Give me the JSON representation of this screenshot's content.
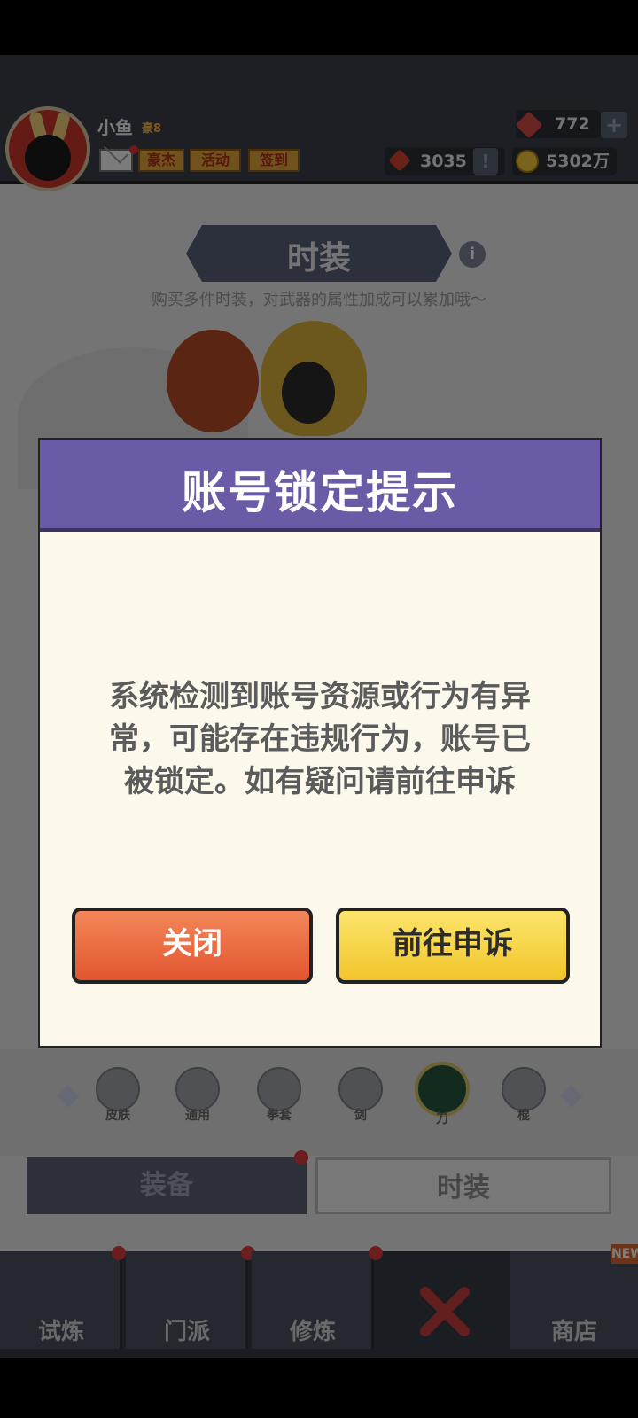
{
  "player": {
    "name": "小鱼",
    "vip": "豪8"
  },
  "hud": {
    "buttons": [
      "豪杰",
      "活动",
      "签到"
    ],
    "gems": "772",
    "tokens": "3035",
    "coins": "5302万"
  },
  "page": {
    "title": "时装",
    "subtitle": "购买多件时装，对武器的属性加成可以累加哦～"
  },
  "weapons": [
    "皮肤",
    "通用",
    "拳套",
    "剑",
    "刀",
    "棍"
  ],
  "tabs": {
    "left": "装备",
    "right": "时装"
  },
  "nav": [
    "试炼",
    "门派",
    "修炼",
    "",
    "商店"
  ],
  "new_badge": "NEW",
  "dialog": {
    "title": "账号锁定提示",
    "message_lines": [
      "系统检测到账号资源或行为有异",
      "常，可能存在违规行为，账号已",
      "被锁定。如有疑问请前往申诉"
    ],
    "close_label": "关闭",
    "appeal_label": "前往申诉"
  }
}
